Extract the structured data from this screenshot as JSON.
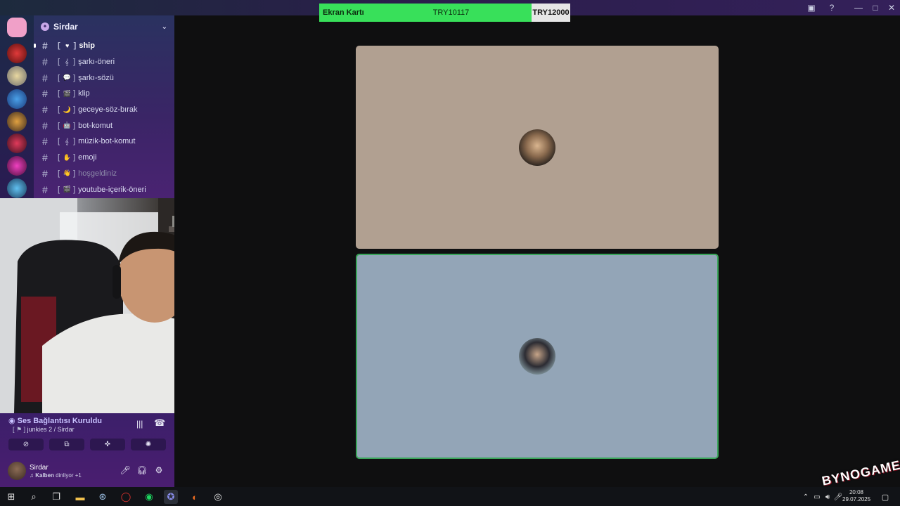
{
  "donation": {
    "label": "Ekran Kartı",
    "current": "TRY10117",
    "goal": "TRY12000",
    "progress_fraction": 0.8431,
    "bar_color": "#38e05a"
  },
  "window_controls": {
    "inbox_icon": "inbox-icon",
    "help_icon": "help-icon",
    "minimize_icon": "minimize-icon",
    "maximize_icon": "maximize-icon",
    "close_icon": "close-icon"
  },
  "server": {
    "name": "Sirdar",
    "channels": [
      {
        "emoji": "♥",
        "name": "ship",
        "active": true
      },
      {
        "emoji": "𝄞",
        "name": "şarkı-öneri"
      },
      {
        "emoji": "💬",
        "name": "şarkı-sözü"
      },
      {
        "emoji": "🎬",
        "name": "klip"
      },
      {
        "emoji": "🌙",
        "name": "geceye-söz-bırak"
      },
      {
        "emoji": "🤖",
        "name": "bot-komut"
      },
      {
        "emoji": "𝄞",
        "name": "müzik-bot-komut"
      },
      {
        "emoji": "✋",
        "name": "emoji"
      },
      {
        "emoji": "👋",
        "name": "hoşgeldiniz",
        "muted": true
      },
      {
        "emoji": "🎬",
        "name": "youtube-içerik-öneri"
      }
    ]
  },
  "voice": {
    "status": "Ses Bağlantısı Kuruldu",
    "channel": "junkies 2 / Sirdar"
  },
  "user": {
    "name": "Sirdar",
    "activity_song": "Kalben",
    "activity_suffix": "dinliyor +1"
  },
  "taskbar": {
    "time": "20:08",
    "date": "29.07.2025"
  },
  "watermark": "BYNOGAME"
}
